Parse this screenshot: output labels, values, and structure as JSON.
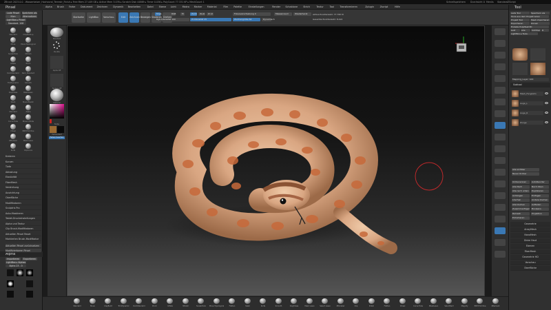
{
  "titlebar": {
    "title": "ZBrush 2023.0.0 - Wasserkaiser_Hochcoral_Terrestr_Finish ▸ Free Mem 27.449 GB ▸ Active Mem 3.076 ▸ Scratch Disk 44869 ▸ Timer 0.036 ▸ PolyCount 77.331 KP ▸ MeshCount 1",
    "right_items": [
      "Schnellspeichern",
      "Durchsicht 0",
      "Menüs",
      "StandardZScript"
    ]
  },
  "menus": [
    "Alpha",
    "Brush",
    "Farbe",
    "Dokument",
    "Zeichnen",
    "Dynamik",
    "Bearbeiten",
    "Datei",
    "Ebene",
    "Licht",
    "Makro",
    "Marker",
    "Material",
    "Film",
    "Palette",
    "Einstellungen",
    "Render",
    "Schablone",
    "Strich",
    "Textur",
    "Tool",
    "Transformieren",
    "Zplugin",
    "Zscript",
    "Hilfe"
  ],
  "shelf": {
    "buttons": [
      "Startseite",
      "LightBox",
      "Vorschau-Fen",
      "Edit",
      "Zeichnen",
      "Bewegen",
      "Skalieren",
      "Drehen"
    ],
    "mrgb": "Mrgb",
    "rgb": "RGB",
    "m": "M",
    "zadd": "Zadd",
    "zsub": "Zsub",
    "zcut": "Zcut",
    "rgb_intensity": "Rgb-Intensität 100",
    "z_intensity": "Z-Intensität 25",
    "focal_shift": "Fokusverschiebung 0",
    "draw_size": "Zeichengröße 64",
    "dynamic": "Dynamisch",
    "active_points": "Aktive Punktanzahl: 77.795 M",
    "total_points": "Gesamte Punktanzahl: 8.422",
    "point_buttons": [
      "Massenraum",
      "Wiederherst."
    ]
  },
  "left_tray": {
    "brush_header": "Pinsel",
    "buttons": [
      "Lade Pinsel",
      "Speichern als",
      "Klon",
      "Alternativen",
      "LightBox ▸ Pinsel"
    ],
    "current_brush": "Standard. 108",
    "brushes": [
      "Standard",
      "ClayBuildup",
      "Move",
      "Move Topological",
      "SnakeHook",
      "hPolish",
      "Inflate",
      "Pinch",
      "DamStandard",
      "Dam_Standard",
      "TrimDynamic",
      "Smooth",
      "ClayTubes",
      "MaskLasso",
      "Slash",
      "Move Elastic",
      "Standard",
      "Alpha",
      "Curve Tube",
      "Move Infinite",
      "Chisel",
      "IMM Primitive",
      "ZModeler",
      "Mask Lasso",
      "Knife",
      "ClipCurve"
    ],
    "sections": [
      "Kreieren",
      "Kurven",
      "Tiefe",
      "Abtastung",
      "Elastizität",
      "FiberMesh",
      "Verdrehung",
      "Ausrichtung",
      "Oberfläche",
      "Modifikatoren",
      "Sculptris Pro",
      "Auto-Maskieren",
      "Tablet-Druckeinstellungen",
      "Alpha und Textur",
      "Clip Brush-Modifikatoren",
      "Aktuellen Pinsel Reset",
      "Markierten Brush-Modifikator"
    ],
    "bottom_buttons": [
      "Aktuellen Pinsel zurücksetzen",
      "Modifizierbaren Pinsel"
    ],
    "alpha_header": "Alpha",
    "alpha_buttons": [
      "Importieren",
      "Exportieren",
      "LightBox ▸ Alphas"
    ],
    "alpha_label": "Alpha 23 - 0"
  },
  "inner_palette": {
    "labels": [
      "Standard",
      "Punkte",
      "Alpha Off",
      "Texture Off",
      "Material",
      "Farbe",
      "Farbverlauf",
      "Farben tauschen"
    ]
  },
  "right_tray": {
    "tool_header": "Tool",
    "top_buttons": [
      "Lade Tool",
      "Speichern als",
      "Tools aus dem Projekt laden",
      "Projekt Tool",
      "Mesh importieren",
      "Exportieren",
      "Klonen",
      "Erstelle PolyMesh3D",
      "GoZ",
      "Alle",
      "Sichtbar",
      "R",
      "LightBox ▸ Tools"
    ],
    "current_tool": "Mapping_Layer: 100",
    "subtool_header": "Subtool",
    "subtools": [
      "Mesh_Fangzahn",
      "Auge_L",
      "Auge_R",
      "Zunge"
    ],
    "subtool_buttons": [
      "Alle sichtbar",
      "Neuer Ordner"
    ],
    "subtool_tools": [
      "Umbenennen",
      "AutoReorder",
      "Alle Nach",
      "Nach Oben",
      "Alle nach unten",
      "Duplizieren",
      "Anhängen",
      "Einfügen",
      "Löschen",
      "Andere löschen",
      "Alle löschen",
      "Aufteilen",
      "Zusammenfügen",
      "Booleans",
      "Remesh",
      "Projektion",
      "Extrahieren"
    ],
    "sections": [
      "Geometrie",
      "ArrayMesh",
      "NanoMesh",
      "Dicke Haut",
      "Ebenen",
      "FiberMesh",
      "Geometrie HD",
      "Vorschau",
      "Oberfläche"
    ]
  },
  "bottom_shelf": {
    "items": [
      "Standard",
      "Move",
      "ClayBuild",
      "TrimDynamic",
      "DamStandard",
      "Pinch",
      "Inflate",
      "hPolish",
      "SnakeHook",
      "Move Topological",
      "Flatten",
      "Slash",
      "Knife",
      "Smooth",
      "ClayTubes",
      "Mask Lasso",
      "Select Lasso",
      "ZModeler",
      "Clip",
      "Polish",
      "Flatten",
      "Chisel",
      "Curve Tube",
      "MaskLasso",
      "SelectRect",
      "Magnify",
      "IMM Primitive",
      "ZRemesh"
    ]
  },
  "viewport": {
    "subject": "coiled snake"
  },
  "colors": {
    "accent": "#3a78b4",
    "panel": "#303030",
    "snake_base": "#e3b896",
    "snake_spot": "#c7693a"
  },
  "icons": [
    "brush-sphere-icon",
    "eye-icon",
    "folder-icon",
    "cursor-circle-icon",
    "navigation-cube-icon"
  ]
}
